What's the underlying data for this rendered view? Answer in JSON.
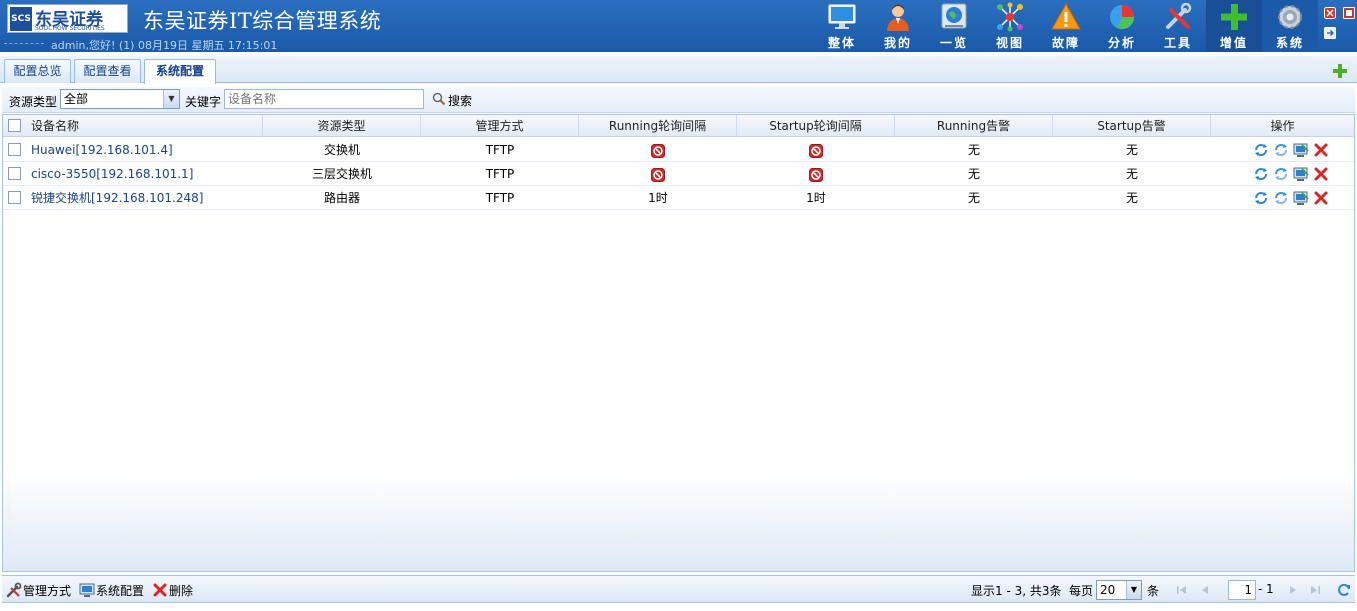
{
  "header": {
    "logo_cn": "东吴证券",
    "logo_en": "SOOCHOW SECURITIES",
    "logo_mark": "SCS",
    "title": "东吴证券IT综合管理系统",
    "welcome": "admin,您好! (1) 08月19日 星期五 17:15:01",
    "nav": [
      {
        "label": "整体",
        "icon": "monitor-icon"
      },
      {
        "label": "我的",
        "icon": "user-icon"
      },
      {
        "label": "一览",
        "icon": "globe-screen-icon"
      },
      {
        "label": "视图",
        "icon": "network-icon"
      },
      {
        "label": "故障",
        "icon": "warning-icon"
      },
      {
        "label": "分析",
        "icon": "pie-chart-icon"
      },
      {
        "label": "工具",
        "icon": "tools-icon"
      },
      {
        "label": "增值",
        "icon": "plus-icon"
      },
      {
        "label": "系统",
        "icon": "gear-icon"
      }
    ],
    "colors": {
      "header_bg": "#1f63b0",
      "active_nav": "#184f96"
    }
  },
  "tabs": [
    {
      "label": "配置总览",
      "active": false
    },
    {
      "label": "配置查看",
      "active": false
    },
    {
      "label": "系统配置",
      "active": true
    }
  ],
  "search": {
    "type_label": "资源类型",
    "type_value": "全部",
    "keyword_label": "关键字",
    "keyword_placeholder": "设备名称",
    "search_label": "搜索"
  },
  "table": {
    "columns": [
      "设备名称",
      "资源类型",
      "管理方式",
      "Running轮询间隔",
      "Startup轮询间隔",
      "Running告警",
      "Startup告警",
      "操作"
    ],
    "rows": [
      {
        "name": "Huawei[192.168.101.4]",
        "type": "交换机",
        "method": "TFTP",
        "running_interval": "",
        "running_disabled": true,
        "startup_interval": "",
        "startup_disabled": true,
        "running_alarm": "无",
        "startup_alarm": "无"
      },
      {
        "name": "cisco-3550[192.168.101.1]",
        "type": "三层交换机",
        "method": "TFTP",
        "running_interval": "",
        "running_disabled": true,
        "startup_interval": "",
        "startup_disabled": true,
        "running_alarm": "无",
        "startup_alarm": "无"
      },
      {
        "name": "锐捷交换机[192.168.101.248]",
        "type": "路由器",
        "method": "TFTP",
        "running_interval": "1时",
        "running_disabled": false,
        "startup_interval": "1时",
        "startup_disabled": false,
        "running_alarm": "无",
        "startup_alarm": "无"
      }
    ]
  },
  "footer": {
    "manage_method": "管理方式",
    "system_config": "系统配置",
    "delete": "删除",
    "display_info": "显示1 - 3, 共3条",
    "per_page_label": "每页",
    "per_page_value": "20",
    "per_page_unit": "条",
    "current_page": "1",
    "page_sep": "-",
    "total_pages": "1"
  }
}
